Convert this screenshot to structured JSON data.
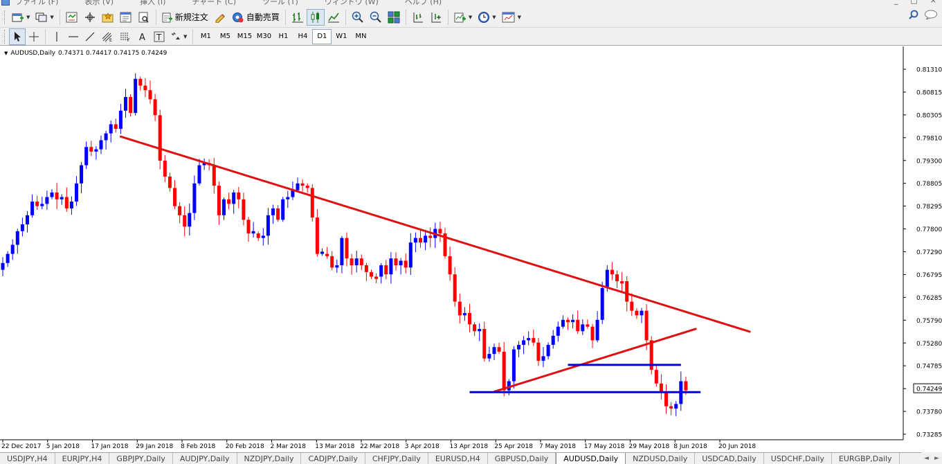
{
  "menubar": {
    "items": [
      "ファイル (F)",
      "表示 (V)",
      "挿入 (I)",
      "チャート (C)",
      "ツール (T)",
      "ウィンドウ (W)",
      "ヘルプ (H)"
    ],
    "window_controls": [
      "_",
      "□",
      "×"
    ]
  },
  "toolbar": {
    "new_order_label": "新規注文",
    "auto_trade_label": "自動売買"
  },
  "timeframes": [
    "M1",
    "M5",
    "M15",
    "M30",
    "H1",
    "H4",
    "D1",
    "W1",
    "MN"
  ],
  "active_timeframe": "D1",
  "chart": {
    "symbol_label": "AUDUSD,Daily",
    "ohlc": "0.74371 0.74417 0.74175 0.74249",
    "current_price": "0.74249",
    "colors": {
      "bull": "#0000ff",
      "bear": "#ff0000",
      "trendline": "#e01010",
      "support": "#0000dd",
      "price_tag_bg": "#ffffff"
    }
  },
  "chart_data": {
    "type": "candlestick",
    "title": "AUDUSD,Daily",
    "price_axis": {
      "ticks": [
        "0.81310",
        "0.80815",
        "0.80305",
        "0.79810",
        "0.79300",
        "0.78805",
        "0.78295",
        "0.77800",
        "0.77290",
        "0.76795",
        "0.76285",
        "0.75790",
        "0.75280",
        "0.74785",
        "0.74249",
        "0.73780",
        "0.73285"
      ],
      "range": [
        0.73,
        0.815
      ]
    },
    "time_axis": {
      "ticks": [
        "22 Dec 2017",
        "5 Jan 2018",
        "17 Jan 2018",
        "29 Jan 2018",
        "8 Feb 2018",
        "20 Feb 2018",
        "2 Mar 2018",
        "13 Mar 2018",
        "22 Mar 2018",
        "3 Apr 2018",
        "13 Apr 2018",
        "25 Apr 2018",
        "7 May 2018",
        "17 May 2018",
        "29 May 2018",
        "8 Jun 2018",
        "20 Jun 2018"
      ]
    },
    "closes": [
      0.7705,
      0.7725,
      0.7745,
      0.7775,
      0.779,
      0.781,
      0.784,
      0.783,
      0.7835,
      0.785,
      0.786,
      0.7845,
      0.785,
      0.7825,
      0.784,
      0.788,
      0.792,
      0.796,
      0.795,
      0.7955,
      0.7975,
      0.799,
      0.801,
      0.8,
      0.804,
      0.807,
      0.8035,
      0.811,
      0.8095,
      0.8085,
      0.8065,
      0.803,
      0.793,
      0.7895,
      0.787,
      0.783,
      0.781,
      0.7785,
      0.7815,
      0.788,
      0.792,
      0.7925,
      0.792,
      0.7875,
      0.781,
      0.7845,
      0.7835,
      0.786,
      0.7845,
      0.78,
      0.777,
      0.777,
      0.776,
      0.7765,
      0.781,
      0.7825,
      0.78,
      0.7845,
      0.785,
      0.7865,
      0.788,
      0.7875,
      0.787,
      0.7805,
      0.7725,
      0.7725,
      0.772,
      0.7695,
      0.77,
      0.776,
      0.7715,
      0.77,
      0.7715,
      0.77,
      0.7685,
      0.7675,
      0.7675,
      0.77,
      0.768,
      0.7715,
      0.77,
      0.771,
      0.7695,
      0.775,
      0.776,
      0.775,
      0.7765,
      0.776,
      0.778,
      0.777,
      0.772,
      0.768,
      0.762,
      0.759,
      0.7595,
      0.757,
      0.7555,
      0.756,
      0.7495,
      0.7505,
      0.752,
      0.751,
      0.7425,
      0.7445,
      0.7515,
      0.7525,
      0.7535,
      0.754,
      0.753,
      0.749,
      0.75,
      0.7525,
      0.7545,
      0.7565,
      0.758,
      0.7575,
      0.758,
      0.7555,
      0.757,
      0.7565,
      0.7535,
      0.758,
      0.765,
      0.769,
      0.768,
      0.7665,
      0.7665,
      0.762,
      0.76,
      0.759,
      0.76,
      0.7535,
      0.747,
      0.744,
      0.742,
      0.739,
      0.7385,
      0.7395,
      0.7445,
      0.7425
    ],
    "annotations": [
      {
        "kind": "trendline",
        "name": "resistance",
        "color": "#e01010",
        "from": [
          24,
          0.7983
        ],
        "to": [
          152,
          0.7554
        ]
      },
      {
        "kind": "trendline",
        "name": "rising support",
        "color": "#e01010",
        "from": [
          100,
          0.7422
        ],
        "to": [
          141,
          0.756
        ]
      },
      {
        "kind": "hline",
        "name": "support-1",
        "color": "#0000dd",
        "price": 0.7481,
        "from_bar": 115,
        "to_bar": 138
      },
      {
        "kind": "hline",
        "name": "support-2",
        "color": "#0000dd",
        "price": 0.7421,
        "from_bar": 95,
        "to_bar": 142
      }
    ]
  },
  "tabs": [
    {
      "label": "USDJPY,H4"
    },
    {
      "label": "EURJPY,H4"
    },
    {
      "label": "GBPJPY,Daily"
    },
    {
      "label": "AUDJPY,Daily"
    },
    {
      "label": "NZDJPY,Daily"
    },
    {
      "label": "CADJPY,Daily"
    },
    {
      "label": "CHFJPY,Daily"
    },
    {
      "label": "EURUSD,H4"
    },
    {
      "label": "GBPUSD,Daily"
    },
    {
      "label": "AUDUSD,Daily",
      "active": true
    },
    {
      "label": "NZDUSD,Daily"
    },
    {
      "label": "USDCAD,Daily"
    },
    {
      "label": "USDCHF,Daily"
    },
    {
      "label": "EURGBP,Daily"
    }
  ],
  "tab_scroll": [
    "◄",
    "►"
  ]
}
